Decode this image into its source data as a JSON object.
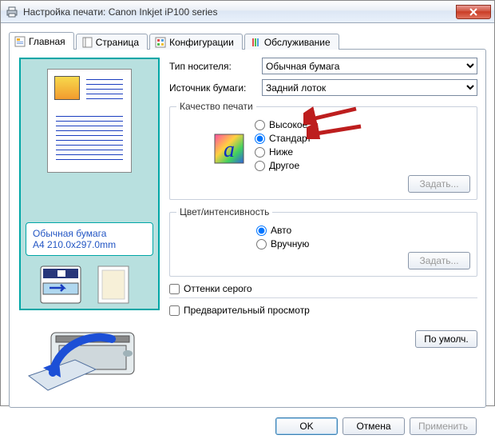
{
  "window": {
    "title": "Настройка печати: Canon Inkjet iP100 series"
  },
  "tabs": {
    "main": "Главная",
    "page": "Страница",
    "config": "Конфигурации",
    "service": "Обслуживание"
  },
  "labels": {
    "media_type": "Тип носителя:",
    "paper_source": "Источник бумаги:",
    "quality_legend": "Качество печати",
    "color_legend": "Цвет/интенсивность",
    "set": "Задать...",
    "grayscale": "Оттенки серого",
    "preview": "Предварительный просмотр",
    "defaults": "По умолч.",
    "ok": "OK",
    "cancel": "Отмена",
    "apply": "Применить"
  },
  "media": {
    "type_value": "Обычная бумага",
    "source_value": "Задний лоток"
  },
  "quality": {
    "high": "Высокое",
    "standard": "Стандарт",
    "low": "Ниже",
    "other": "Другое",
    "selected": "standard"
  },
  "color": {
    "auto": "Авто",
    "manual": "Вручную",
    "selected": "auto"
  },
  "paper_info": {
    "line1": "Обычная бумага",
    "line2": "A4 210.0x297.0mm"
  }
}
